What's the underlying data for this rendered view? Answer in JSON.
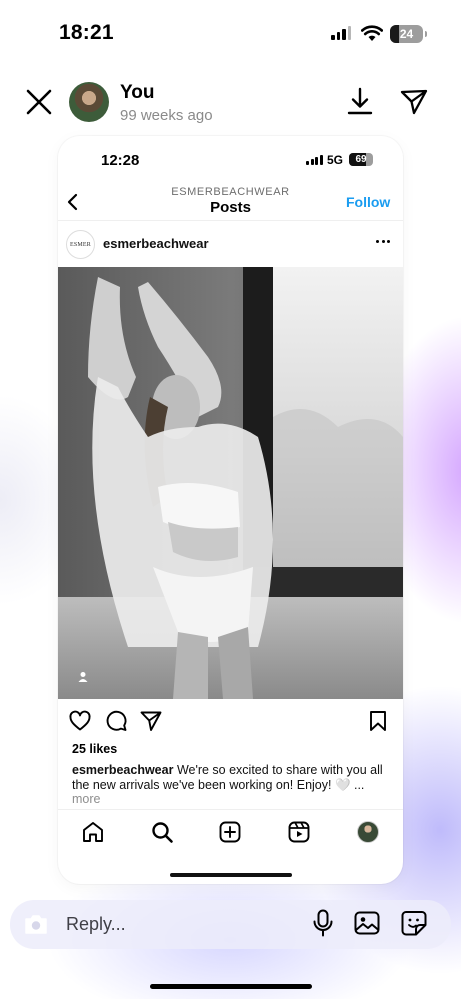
{
  "status_bar": {
    "time": "18:21",
    "battery": "24"
  },
  "story_header": {
    "username": "You",
    "time_ago": "99 weeks ago"
  },
  "shared_post": {
    "status_bar": {
      "time": "12:28",
      "network": "5G",
      "battery": "69"
    },
    "nav": {
      "overline": "ESMERBEACHWEAR",
      "title": "Posts",
      "follow_label": "Follow"
    },
    "post": {
      "avatar_text": "ESMER",
      "username": "esmerbeachwear",
      "likes": "25 likes",
      "caption_user": "esmerbeachwear",
      "caption_text": "We're so excited to share with you all the new arrivals we've been working on! Enjoy! 🤍 ...",
      "more_label": "more"
    }
  },
  "reply_bar": {
    "placeholder": "Reply..."
  },
  "icons": [
    "close-icon",
    "download-icon",
    "send-icon",
    "back-chevron-icon",
    "more-icon",
    "person-tag-icon",
    "heart-icon",
    "comment-icon",
    "share-icon",
    "bookmark-icon",
    "home-icon",
    "search-icon",
    "create-icon",
    "reels-icon",
    "camera-icon",
    "microphone-icon",
    "gallery-icon",
    "sticker-icon"
  ],
  "colors": {
    "accent": "#1a9cf0",
    "muted": "#8a8a8a"
  }
}
